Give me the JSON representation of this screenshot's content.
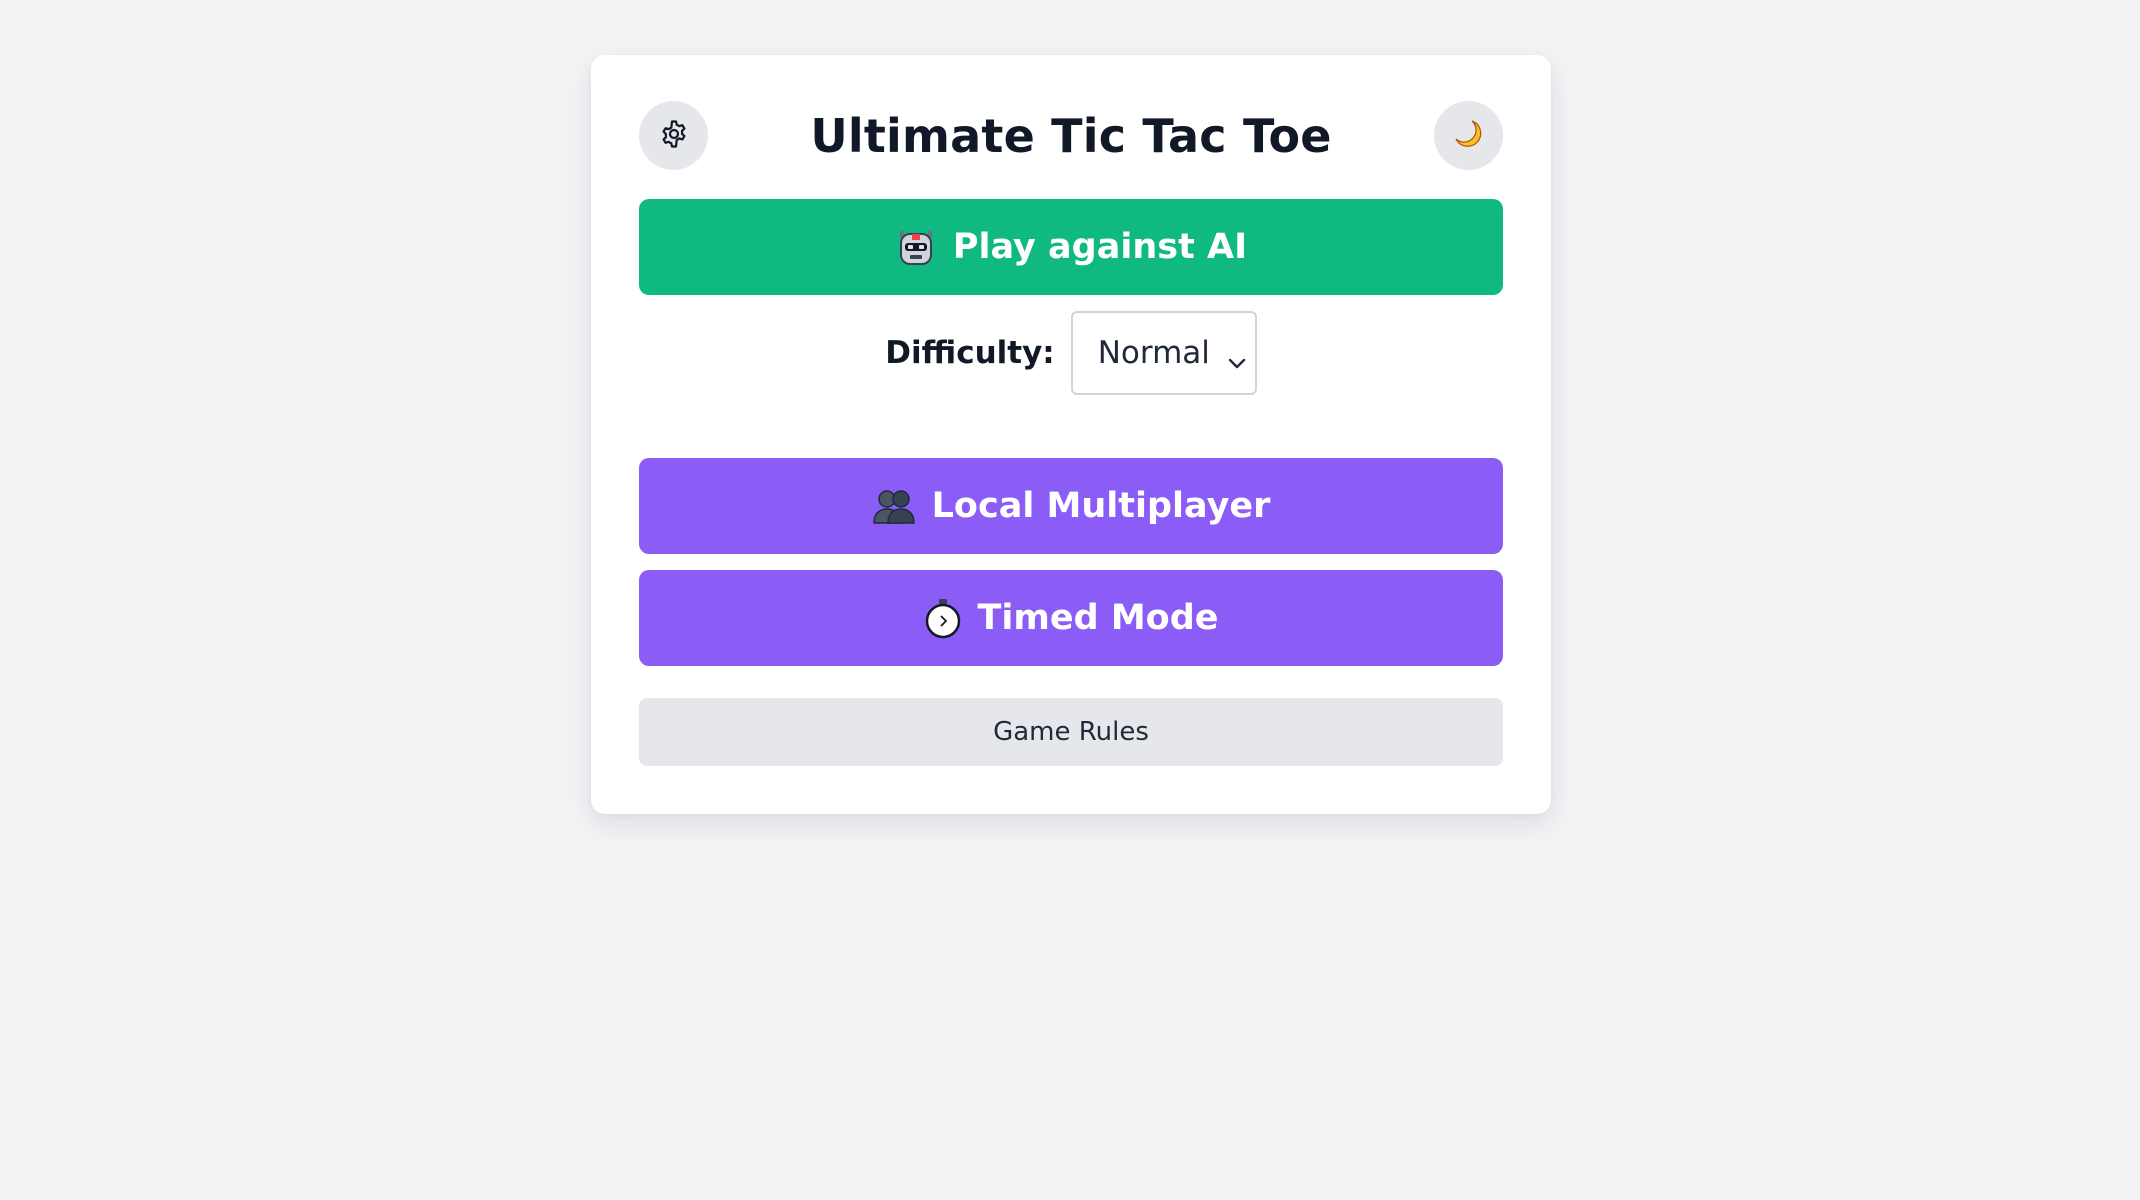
{
  "app": {
    "title": "Ultimate Tic Tac Toe"
  },
  "header": {
    "settings_icon": "gear-icon",
    "theme_icon": "moon-icon"
  },
  "menu": {
    "play_ai": {
      "label": "Play against AI",
      "icon": "robot-icon",
      "color": "#10b981"
    },
    "difficulty": {
      "label": "Difficulty:",
      "selected": "Normal"
    },
    "local_multiplayer": {
      "label": "Local Multiplayer",
      "icon": "two-people-icon",
      "color": "#8b5cf6"
    },
    "timed_mode": {
      "label": "Timed Mode",
      "icon": "stopwatch-icon",
      "color": "#8b5cf6"
    },
    "game_rules": {
      "label": "Game Rules"
    }
  },
  "colors": {
    "background": "#f2f3f5",
    "card": "#ffffff",
    "green": "#10b981",
    "purple": "#8b5cf6",
    "neutral": "#e5e7eb"
  }
}
